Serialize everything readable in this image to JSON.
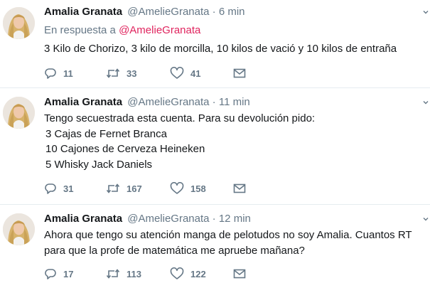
{
  "tweets": [
    {
      "name": "Amalia Granata",
      "handle": "@AmelieGranata",
      "time": "6 min",
      "reply_prefix": "En respuesta a",
      "reply_to": "@AmelieGranata",
      "text_lines": [
        "3 Kilo de Chorizo, 3 kilo de morcilla, 10 kilos de vació y 10 kilos de entraña"
      ],
      "replies": "11",
      "retweets": "33",
      "likes": "41"
    },
    {
      "name": "Amalia Granata",
      "handle": "@AmelieGranata",
      "time": "11 min",
      "text_lines": [
        "Tengo secuestrada esta cuenta. Para su devolución pido:",
        "3 Cajas de Fernet Branca",
        "10 Cajones de Cerveza Heineken",
        "5 Whisky Jack Daniels"
      ],
      "replies": "31",
      "retweets": "167",
      "likes": "158"
    },
    {
      "name": "Amalia Granata",
      "handle": "@AmelieGranata",
      "time": "12 min",
      "text_lines": [
        "Ahora que tengo su atención manga de pelotudos no soy Amalia. Cuantos RT",
        "para que la profe de matemática me apruebe mañana?"
      ],
      "replies": "17",
      "retweets": "113",
      "likes": "122"
    }
  ],
  "separator_text": "·",
  "icons": {
    "reply": "reply-icon",
    "retweet": "retweet-icon",
    "like": "heart-icon",
    "dm": "envelope-icon",
    "more": "chevron-down-icon"
  },
  "colors": {
    "mention": "#e0245e",
    "muted": "#657786",
    "text": "#14171a"
  }
}
